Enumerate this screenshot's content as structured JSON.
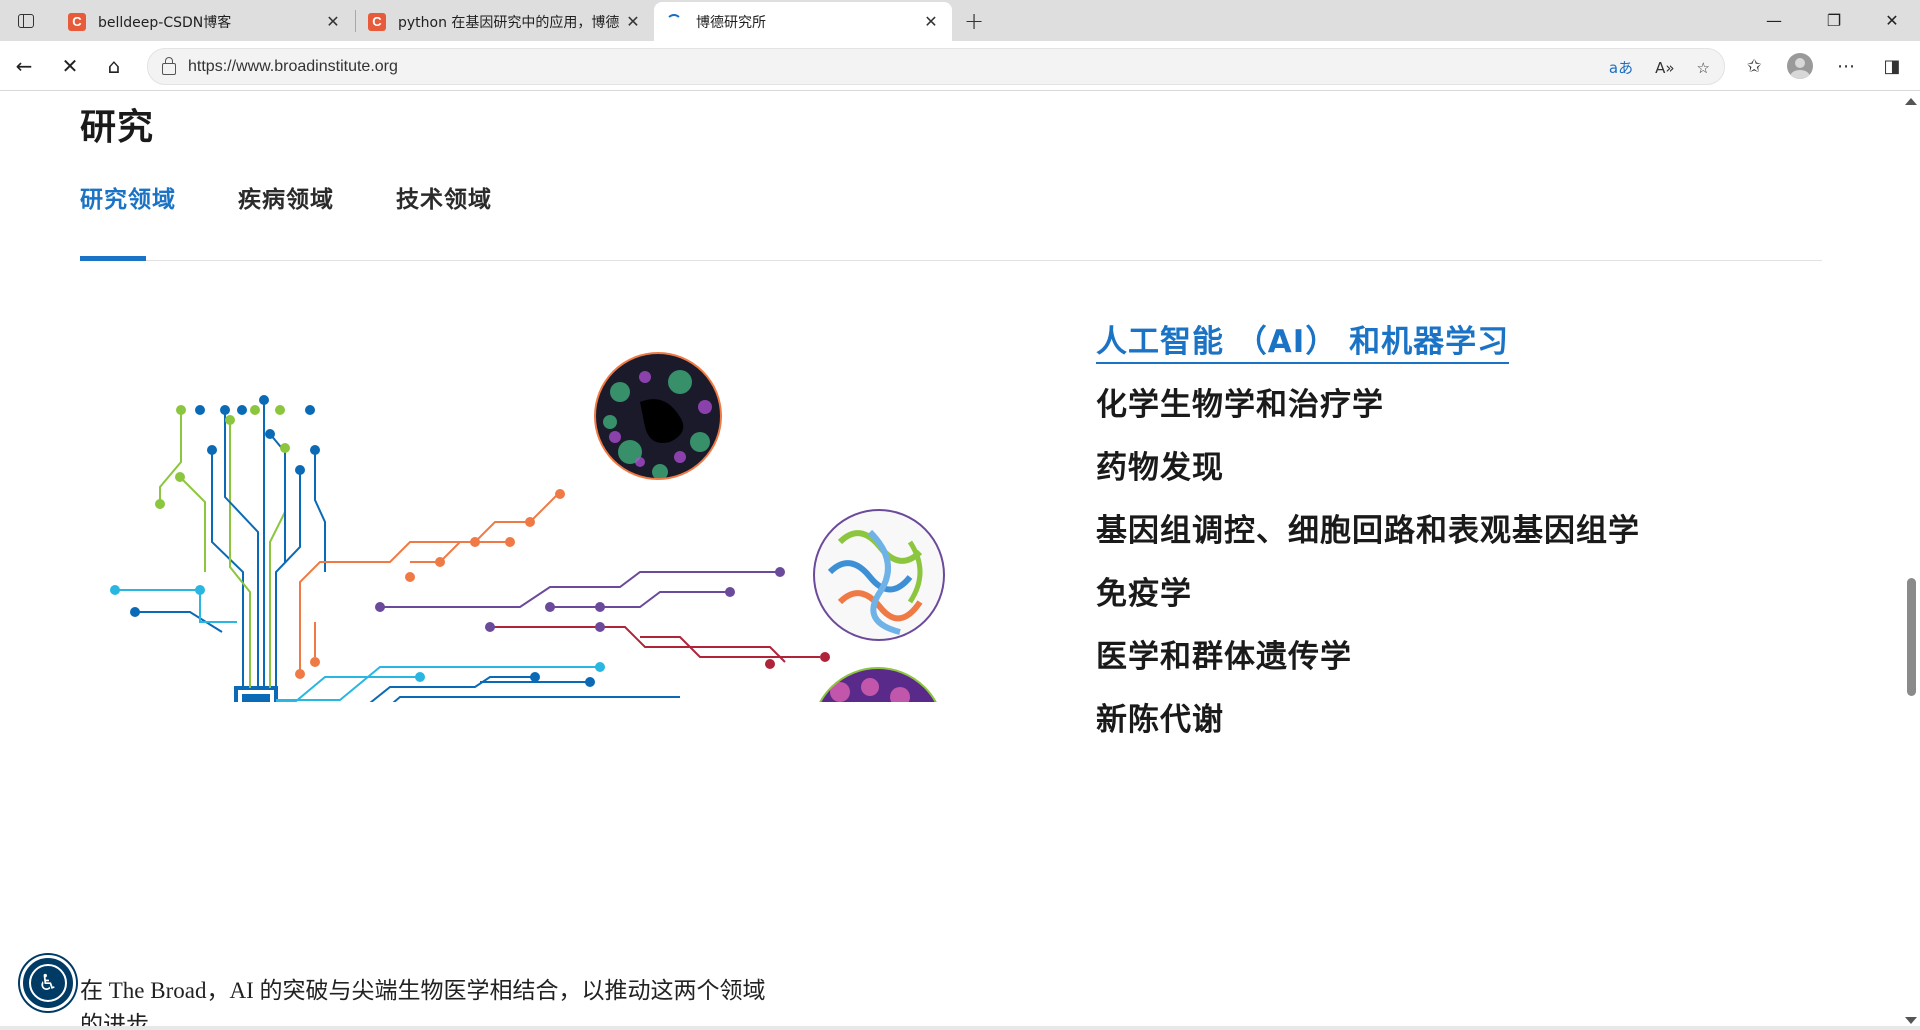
{
  "browser": {
    "tabs": [
      {
        "title": "belldeep-CSDN博客",
        "favicon": "C"
      },
      {
        "title": "python 在基因研究中的应用，博德",
        "favicon": "C"
      },
      {
        "title": "博德研究所",
        "favicon": "loading-spinner"
      }
    ],
    "url": "https://www.broadinstitute.org",
    "translate_label": "aあ",
    "read_aloud_label": "A»"
  },
  "page": {
    "heading": "研究",
    "tabs": [
      "研究领域",
      "疾病领域",
      "技术领域"
    ],
    "active_tab": 0,
    "areas": [
      "人工智能 （AI） 和机器学习",
      "化学生物学和治疗学",
      "药物发现",
      "基因组调控、细胞回路和表观基因组学",
      "免疫学",
      "医学和群体遗传学",
      "新陈代谢"
    ],
    "description": "在 The Broad，AI 的突破与尖端生物医学相结合，以推动这两个领域的进步"
  },
  "colors": {
    "accent": "#1a73c4",
    "chip": "#0a6ab6",
    "orange": "#ef7a45",
    "purple": "#6b4a9b",
    "green": "#8cc63f",
    "cyan": "#29b6e0",
    "darkred": "#b0243a",
    "a11y": "#003b66"
  }
}
